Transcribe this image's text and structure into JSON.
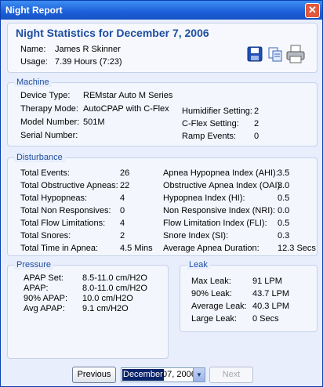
{
  "window": {
    "title": "Night Report"
  },
  "header": {
    "heading": "Night Statistics for December 7, 2006",
    "name_label": "Name:",
    "name_value": "James R Skinner",
    "usage_label": "Usage:",
    "usage_value": "7.39 Hours  (7:23)"
  },
  "machine": {
    "legend": "Machine",
    "rows": [
      {
        "label": "Device Type:",
        "value": "REMstar Auto M Series"
      },
      {
        "label": "Therapy Mode:",
        "value": "AutoCPAP with C-Flex"
      },
      {
        "label": "Model Number:",
        "value": "501M"
      },
      {
        "label": "Serial Number:",
        "value": ""
      }
    ],
    "right_rows": [
      {
        "label": "Humidifier Setting:",
        "value": "2"
      },
      {
        "label": "C-Flex Setting:",
        "value": "2"
      },
      {
        "label": "Ramp Events:",
        "value": "0"
      }
    ]
  },
  "disturbance": {
    "legend": "Disturbance",
    "left": [
      {
        "label": "Total Events:",
        "value": "26"
      },
      {
        "label": "Total Obstructive Apneas:",
        "value": "22"
      },
      {
        "label": "Total Hypopneas:",
        "value": "4"
      },
      {
        "label": "Total Non Responsives:",
        "value": "0"
      },
      {
        "label": "Total Flow Limitations:",
        "value": "4"
      },
      {
        "label": "Total Snores:",
        "value": "2"
      },
      {
        "label": "Total Time in Apnea:",
        "value": "4.5 Mins"
      }
    ],
    "right": [
      {
        "label": "Apnea Hypopnea Index (AHI):",
        "value": "3.5"
      },
      {
        "label": "Obstructive Apnea Index (OAI):",
        "value": "3.0"
      },
      {
        "label": "Hypopnea Index (HI):",
        "value": "0.5"
      },
      {
        "label": "Non Responsive Index (NRI):",
        "value": "0.0"
      },
      {
        "label": "Flow Limitation Index (FLI):",
        "value": "0.5"
      },
      {
        "label": "Snore Index (SI):",
        "value": "0.3"
      },
      {
        "label": "Average Apnea Duration:",
        "value": "12.3 Secs"
      }
    ]
  },
  "pressure": {
    "legend": "Pressure",
    "rows": [
      {
        "label": "APAP Set:",
        "value": "8.5-11.0 cm/H2O"
      },
      {
        "label": "APAP:",
        "value": "8.0-11.0 cm/H2O"
      },
      {
        "label": "90% APAP:",
        "value": "10.0 cm/H2O"
      },
      {
        "label": "Avg APAP:",
        "value": "9.1 cm/H2O"
      }
    ]
  },
  "leak": {
    "legend": "Leak",
    "rows": [
      {
        "label": "Max Leak:",
        "value": "91 LPM"
      },
      {
        "label": "90% Leak:",
        "value": "43.7 LPM"
      },
      {
        "label": "Average Leak:",
        "value": "40.3 LPM"
      },
      {
        "label": "Large Leak:",
        "value": "0 Secs"
      }
    ]
  },
  "nav": {
    "previous_label": "Previous",
    "next_label": "Next",
    "date_month": "December",
    "date_rest": " 07, 2006"
  },
  "icons": [
    "save-icon",
    "copy-icon",
    "print-icon",
    "close-icon",
    "dropdown-arrow-icon"
  ],
  "colors": {
    "titlebar": "#1c5fd8",
    "heading": "#1e4ea0",
    "background": "#e8eefc"
  }
}
